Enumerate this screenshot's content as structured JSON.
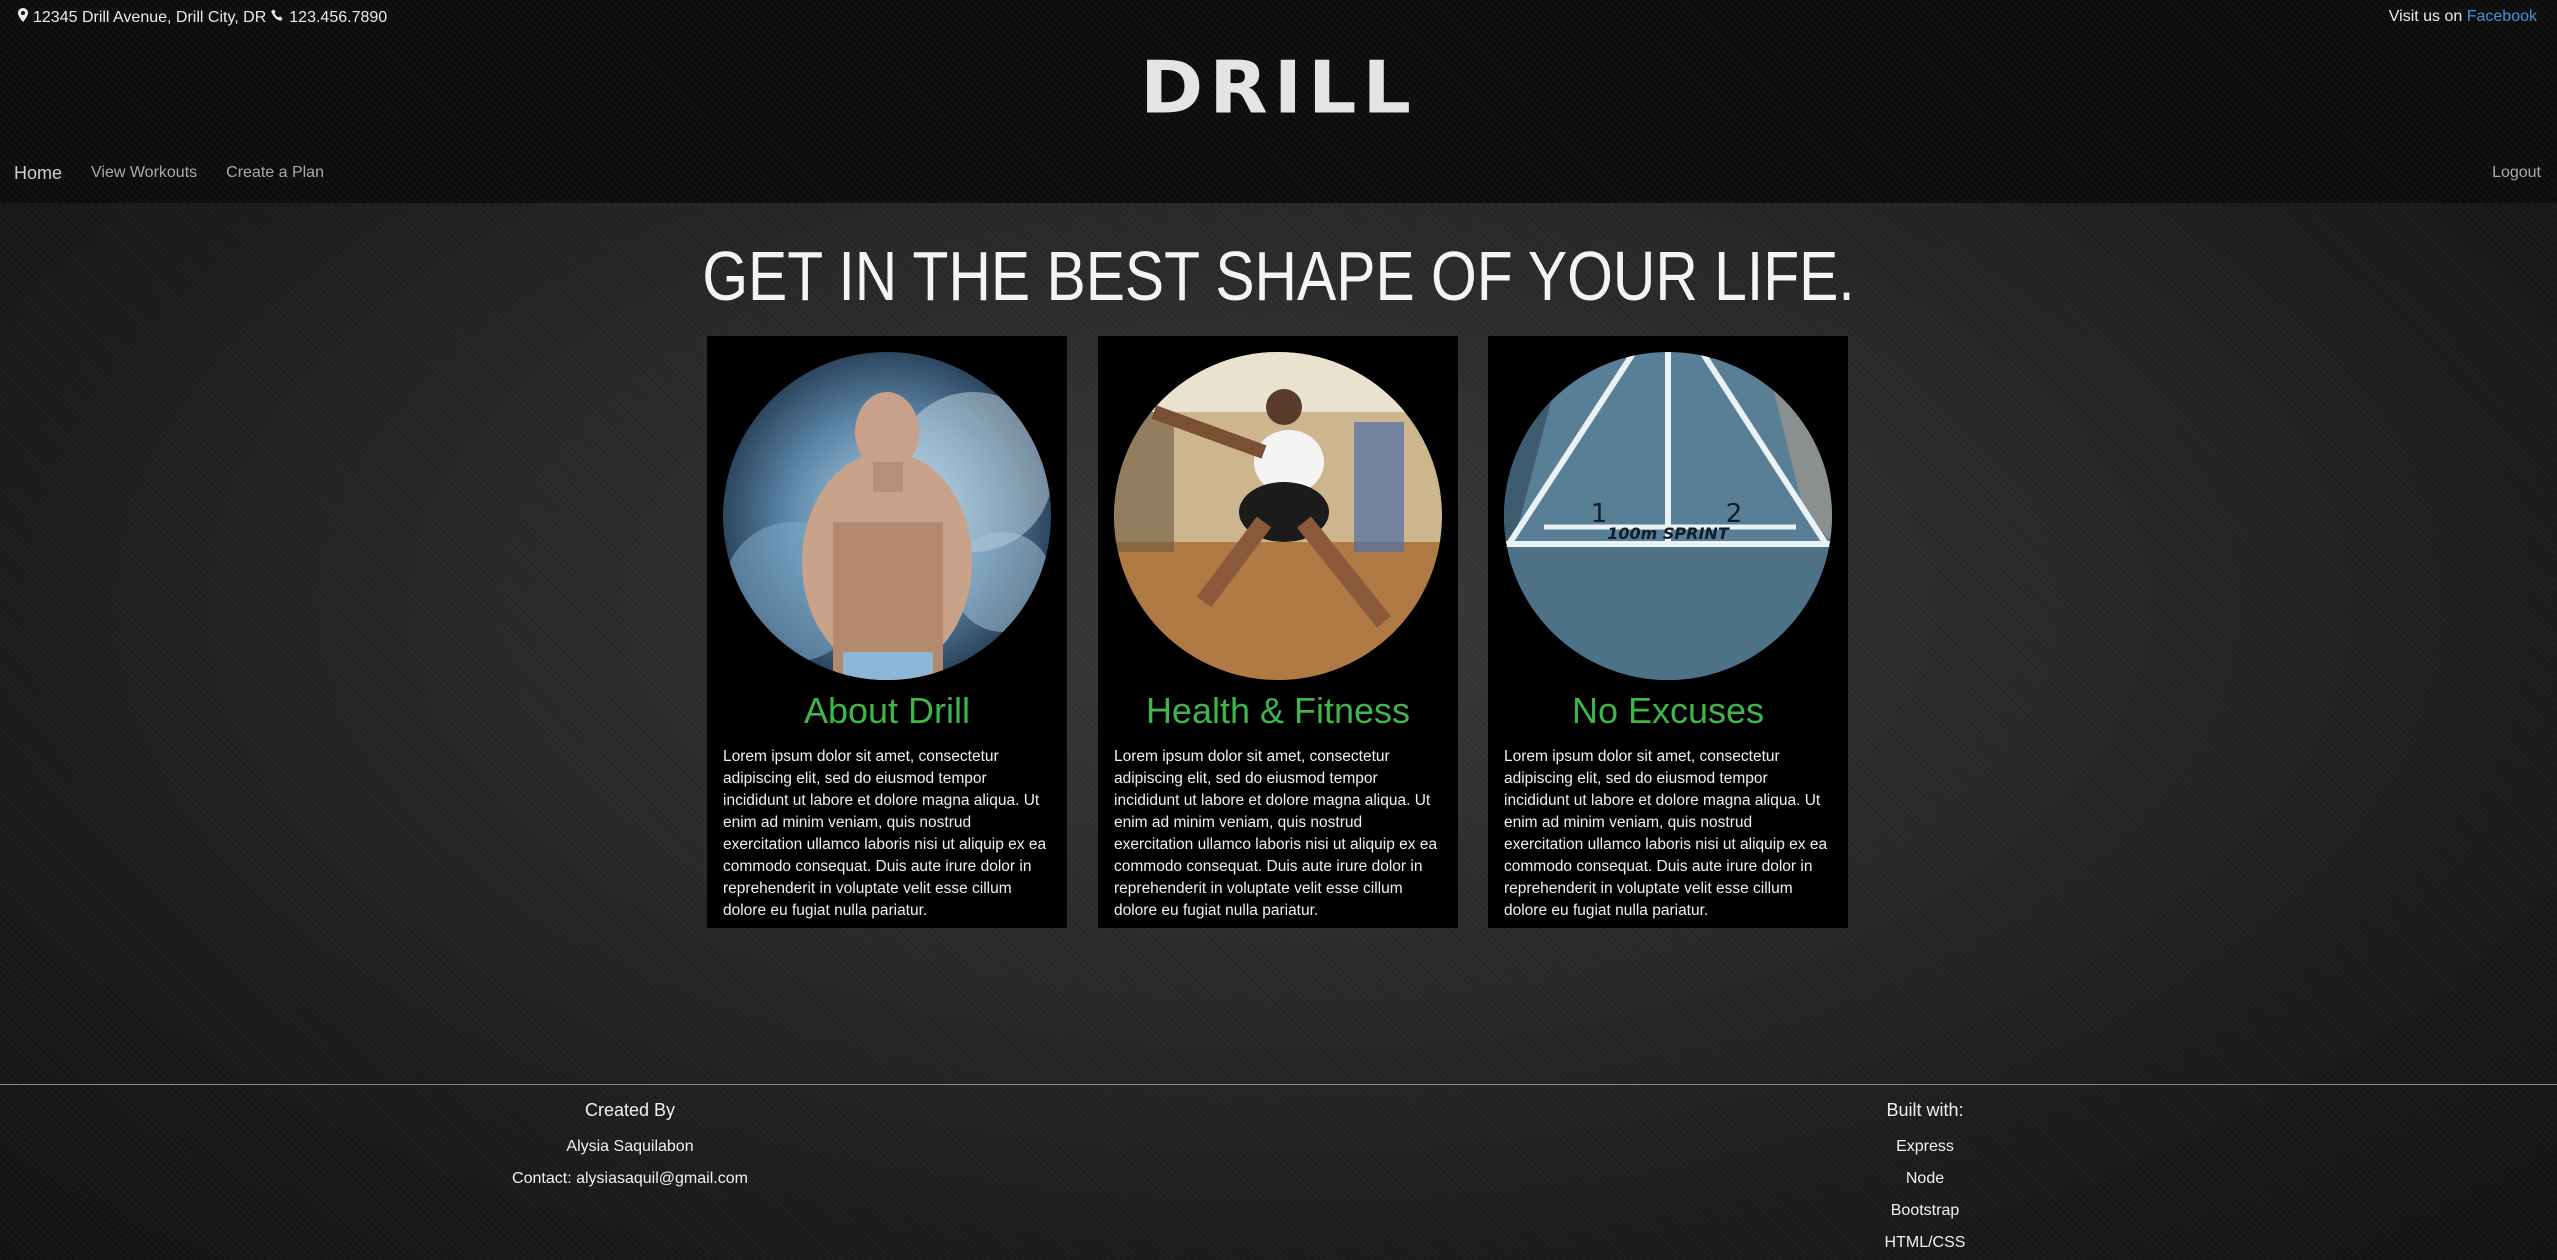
{
  "header": {
    "address": "12345 Drill Avenue, Drill City, DR",
    "phone": "123.456.7890",
    "visit_prefix": "Visit us on",
    "visit_link": "Facebook",
    "logo": "DRILL"
  },
  "nav": {
    "items": [
      "Home",
      "View Workouts",
      "Create a Plan"
    ],
    "logout": "Logout"
  },
  "hero": {
    "title": "GET IN THE BEST SHAPE OF YOUR LIFE."
  },
  "cards": [
    {
      "title": "About Drill",
      "text": "Lorem ipsum dolor sit amet, consectetur adipiscing elit, sed do eiusmod tempor incididunt ut labore et dolore magna aliqua. Ut enim ad minim veniam, quis nostrud exercitation ullamco laboris nisi ut aliquip ex ea commodo consequat. Duis aute irure dolor in reprehenderit in voluptate velit esse cillum dolore eu fugiat nulla pariatur."
    },
    {
      "title": "Health & Fitness",
      "text": "Lorem ipsum dolor sit amet, consectetur adipiscing elit, sed do eiusmod tempor incididunt ut labore et dolore magna aliqua. Ut enim ad minim veniam, quis nostrud exercitation ullamco laboris nisi ut aliquip ex ea commodo consequat. Duis aute irure dolor in reprehenderit in voluptate velit esse cillum dolore eu fugiat nulla pariatur."
    },
    {
      "title": "No Excuses",
      "text": "Lorem ipsum dolor sit amet, consectetur adipiscing elit, sed do eiusmod tempor incididunt ut labore et dolore magna aliqua. Ut enim ad minim veniam, quis nostrud exercitation ullamco laboris nisi ut aliquip ex ea commodo consequat. Duis aute irure dolor in reprehenderit in voluptate velit esse cillum dolore eu fugiat nulla pariatur.",
      "track_lanes": [
        "1",
        "2"
      ],
      "track_text": "100m SPRINT"
    }
  ],
  "footer": {
    "created_by_label": "Created By",
    "author": "Alysia Saquilabon",
    "contact": "Contact: alysiasaquil@gmail.com",
    "built_with_label": "Built with:",
    "tech": [
      "Express",
      "Node",
      "Bootstrap",
      "HTML/CSS"
    ]
  },
  "colors": {
    "accent_green": "#3fb54a",
    "link_blue": "#4a90d9"
  }
}
